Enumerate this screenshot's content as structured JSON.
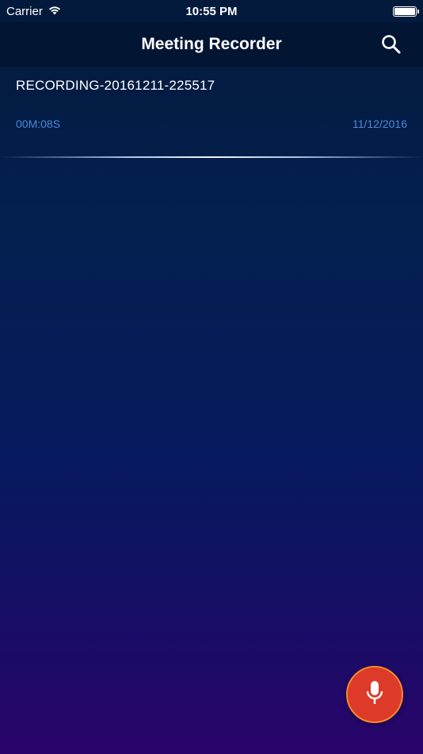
{
  "status_bar": {
    "carrier": "Carrier",
    "time": "10:55 PM",
    "battery_level": 1.0
  },
  "nav": {
    "title": "Meeting Recorder",
    "search_icon": "search-icon"
  },
  "recordings": [
    {
      "name": "RECORDING-20161211-225517",
      "duration": "00M:08S",
      "date": "11/12/2016"
    }
  ],
  "fab": {
    "icon": "microphone-icon"
  },
  "colors": {
    "accent_text": "#4f88d8",
    "fab_background": "#dd3a2a",
    "fab_border": "#f48a2c"
  }
}
